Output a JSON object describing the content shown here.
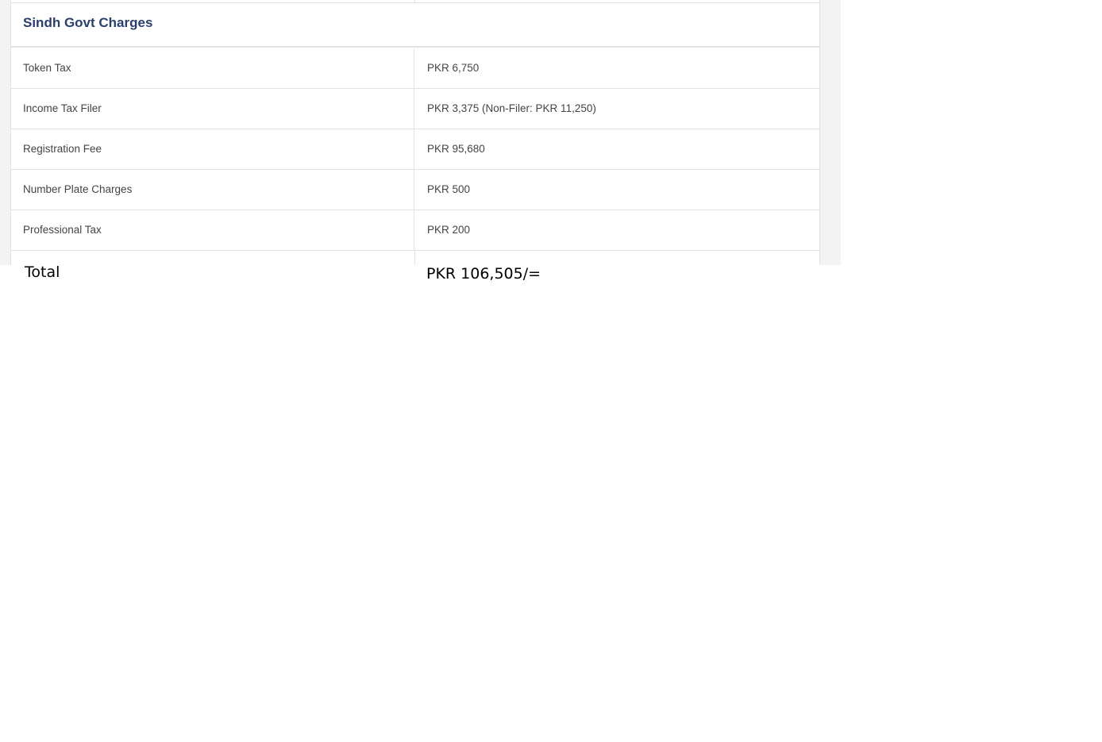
{
  "section": {
    "title": "Sindh Govt Charges"
  },
  "charges": [
    {
      "label": "Token Tax",
      "value": "PKR 6,750"
    },
    {
      "label": "Income Tax Filer",
      "value": "PKR 3,375 (Non-Filer: PKR 11,250)"
    },
    {
      "label": "Registration Fee",
      "value": "PKR 95,680"
    },
    {
      "label": "Number Plate Charges",
      "value": "PKR 500"
    },
    {
      "label": "Professional Tax",
      "value": "PKR 200"
    }
  ],
  "total": {
    "label": "Total",
    "value": "PKR 106,505/="
  },
  "colors": {
    "title": "#2b3f6c",
    "text": "#444444",
    "border": "#e2e2e2",
    "panel_background": "#f3f3f3"
  }
}
